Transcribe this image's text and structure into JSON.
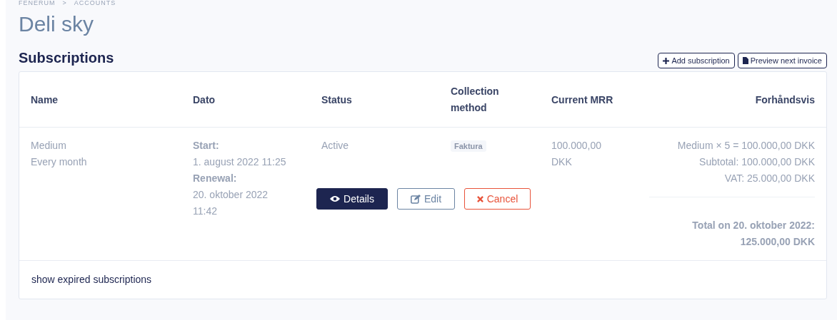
{
  "breadcrumb": [
    "FENERUM",
    ">",
    "ACCOUNTS"
  ],
  "title": "Deli sky",
  "section": {
    "title": "Subscriptions",
    "actions": [
      {
        "kind": "add",
        "label": "Add subscription"
      },
      {
        "kind": "preview",
        "label": "Preview next invoice"
      }
    ]
  },
  "table": {
    "columns": [
      "Name",
      "Dato",
      "Status",
      "Collection method",
      "Current MRR",
      "Forhåndsvis"
    ],
    "rows": [
      {
        "dimmed": true,
        "name": "Medium",
        "interval": "Every month",
        "start_label": "Start:",
        "start": "1. august 2022 11:25",
        "renewal_label": "Renewal:",
        "renewal": "20. oktober 2022 11:42",
        "status": "Active",
        "collection_method": "Faktura",
        "mrr": "100.000,00 DKK",
        "preview_lines": [
          "Medium × 5 = 100.000,00 DKK",
          "Subtotal: 100.000,00 DKK",
          "VAT: 25.000,00 DKK"
        ],
        "total": "Total on 20. oktober 2022: 125.000,00 DKK",
        "buttons": [
          {
            "kind": "details",
            "label": "Details"
          },
          {
            "kind": "edit",
            "label": "Edit"
          },
          {
            "kind": "cancel",
            "label": "Cancel"
          }
        ]
      }
    ]
  },
  "footer_link": "show expired subscriptions"
}
